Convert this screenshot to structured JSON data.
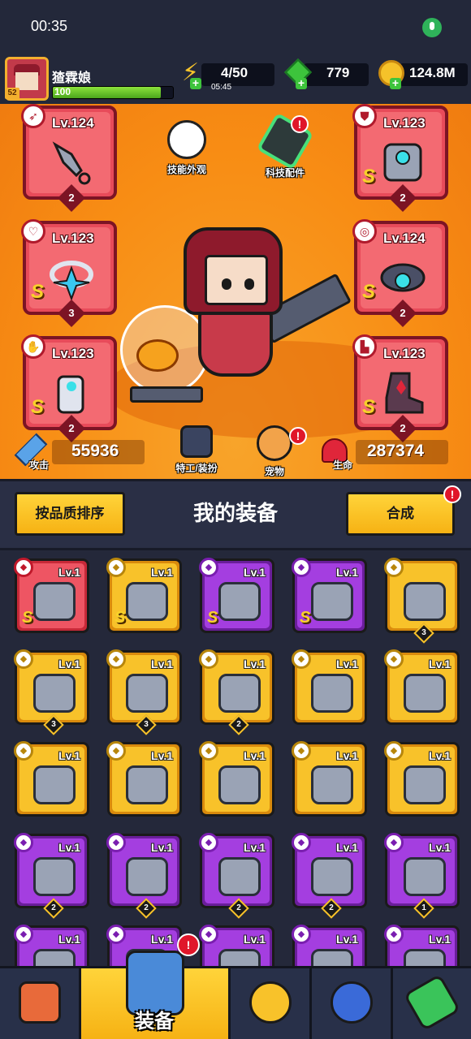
{
  "status_bar": {
    "time": "00:35",
    "mic_icon": "mic-icon"
  },
  "player": {
    "name": "猹霖娘",
    "level": "52",
    "xp_value": "100",
    "xp_fraction": 0.9
  },
  "resources": {
    "energy": "4/50",
    "energy_timer": "05:45",
    "gems": "779",
    "coins": "124.8M"
  },
  "equipped": [
    {
      "slot": "weapon",
      "level": "Lv.124",
      "count": "2",
      "s_rank": false,
      "type_icon": "weapon-type-icon"
    },
    {
      "slot": "armor",
      "level": "Lv.123",
      "count": "2",
      "s_rank": true,
      "type_icon": "armor-type-icon"
    },
    {
      "slot": "necklace",
      "level": "Lv.123",
      "count": "3",
      "s_rank": true,
      "type_icon": "necklace-type-icon"
    },
    {
      "slot": "belt",
      "level": "Lv.124",
      "count": "2",
      "s_rank": true,
      "type_icon": "belt-type-icon"
    },
    {
      "slot": "gloves",
      "level": "Lv.123",
      "count": "2",
      "s_rank": true,
      "type_icon": "gloves-type-icon"
    },
    {
      "slot": "boots",
      "level": "Lv.123",
      "count": "2",
      "s_rank": true,
      "type_icon": "boots-type-icon"
    }
  ],
  "hero_buttons": {
    "skin": "技能外观",
    "tech": "科技配件",
    "agent": "特工/装扮",
    "pet": "宠物"
  },
  "stats": {
    "attack_label": "攻击",
    "attack": "55936",
    "hp_label": "生命",
    "hp": "287374"
  },
  "toolbar": {
    "sort": "按品质排序",
    "title": "我的装备",
    "merge": "合成"
  },
  "inventory": [
    {
      "q": "red",
      "lv": "Lv.1",
      "s": true,
      "cnt": ""
    },
    {
      "q": "yellow",
      "lv": "Lv.1",
      "s": true,
      "cnt": ""
    },
    {
      "q": "purple",
      "lv": "Lv.1",
      "s": true,
      "cnt": ""
    },
    {
      "q": "purple",
      "lv": "Lv.1",
      "s": true,
      "cnt": ""
    },
    {
      "q": "yellow",
      "lv": "",
      "s": false,
      "cnt": "3"
    },
    {
      "q": "yellow",
      "lv": "Lv.1",
      "s": false,
      "cnt": "3"
    },
    {
      "q": "yellow",
      "lv": "Lv.1",
      "s": false,
      "cnt": "3"
    },
    {
      "q": "yellow",
      "lv": "Lv.1",
      "s": false,
      "cnt": "2"
    },
    {
      "q": "yellow",
      "lv": "Lv.1",
      "s": false,
      "cnt": ""
    },
    {
      "q": "yellow",
      "lv": "Lv.1",
      "s": false,
      "cnt": ""
    },
    {
      "q": "yellow",
      "lv": "Lv.1",
      "s": false,
      "cnt": ""
    },
    {
      "q": "yellow",
      "lv": "Lv.1",
      "s": false,
      "cnt": ""
    },
    {
      "q": "yellow",
      "lv": "Lv.1",
      "s": false,
      "cnt": ""
    },
    {
      "q": "yellow",
      "lv": "Lv.1",
      "s": false,
      "cnt": ""
    },
    {
      "q": "yellow",
      "lv": "Lv.1",
      "s": false,
      "cnt": ""
    },
    {
      "q": "purple",
      "lv": "Lv.1",
      "s": false,
      "cnt": "2"
    },
    {
      "q": "purple",
      "lv": "Lv.1",
      "s": false,
      "cnt": "2"
    },
    {
      "q": "purple",
      "lv": "Lv.1",
      "s": false,
      "cnt": "2"
    },
    {
      "q": "purple",
      "lv": "Lv.1",
      "s": false,
      "cnt": "2"
    },
    {
      "q": "purple",
      "lv": "Lv.1",
      "s": false,
      "cnt": "1"
    },
    {
      "q": "purple",
      "lv": "Lv.1",
      "s": false,
      "cnt": ""
    },
    {
      "q": "purple",
      "lv": "Lv.1",
      "s": false,
      "cnt": ""
    },
    {
      "q": "purple",
      "lv": "Lv.1",
      "s": false,
      "cnt": ""
    },
    {
      "q": "purple",
      "lv": "Lv.1",
      "s": false,
      "cnt": ""
    },
    {
      "q": "purple",
      "lv": "Lv.1",
      "s": false,
      "cnt": ""
    }
  ],
  "nav": {
    "equip_label": "装备"
  },
  "colors": {
    "hero_bg": "#f88d14",
    "red_quality": "#ee5563",
    "yellow_quality": "#f8c22a",
    "purple_quality": "#a43ee0"
  }
}
